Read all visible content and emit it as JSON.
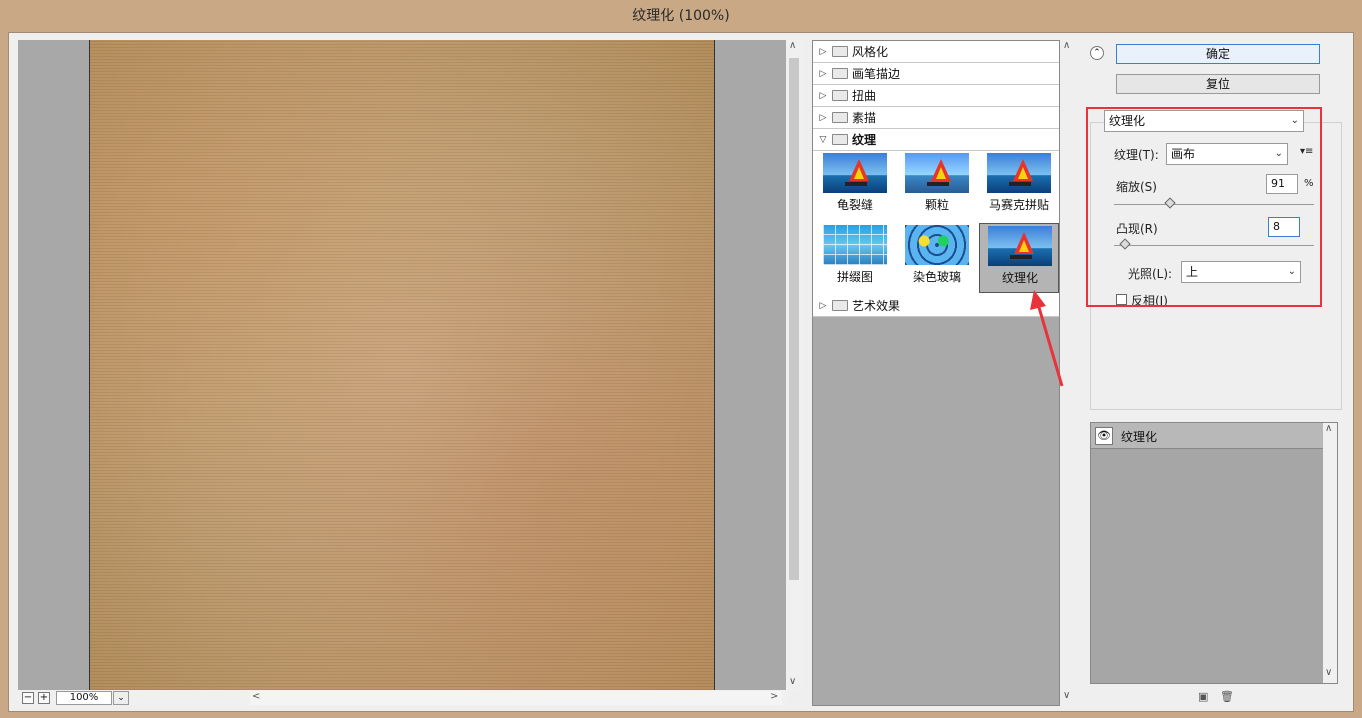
{
  "window": {
    "title": "纹理化 (100%)"
  },
  "preview": {
    "zoom": "100%",
    "zoom_out": "−",
    "zoom_in": "+",
    "dropdown": "⌄"
  },
  "gallery": {
    "categories": [
      {
        "label": "风格化",
        "open": false
      },
      {
        "label": "画笔描边",
        "open": false
      },
      {
        "label": "扭曲",
        "open": false
      },
      {
        "label": "素描",
        "open": false
      },
      {
        "label": "纹理",
        "open": true
      }
    ],
    "thumbnails": [
      {
        "label": "龟裂缝",
        "style": "boat"
      },
      {
        "label": "颗粒",
        "style": "boat"
      },
      {
        "label": "马赛克拼贴",
        "style": "boat"
      },
      {
        "label": "拼缀图",
        "style": "tiles"
      },
      {
        "label": "染色玻璃",
        "style": "glass"
      },
      {
        "label": "纹理化",
        "style": "boat",
        "selected": true
      }
    ],
    "after": {
      "label": "艺术效果"
    }
  },
  "buttons": {
    "ok": "确定",
    "reset": "复位"
  },
  "settings": {
    "filter_select": "纹理化",
    "texture_label": "纹理(T):",
    "texture_value": "画布",
    "scaling_label": "缩放(S)",
    "scaling_value": "91",
    "scaling_unit": "%",
    "relief_label": "凸现(R)",
    "relief_value": "8",
    "light_label": "光照(L):",
    "light_value": "上",
    "invert_label": "反相(I)",
    "invert_checked": false
  },
  "layers": {
    "items": [
      {
        "name": "纹理化"
      }
    ]
  },
  "colors": {
    "highlight": "#e8333a",
    "accent": "#3b7fd3"
  }
}
